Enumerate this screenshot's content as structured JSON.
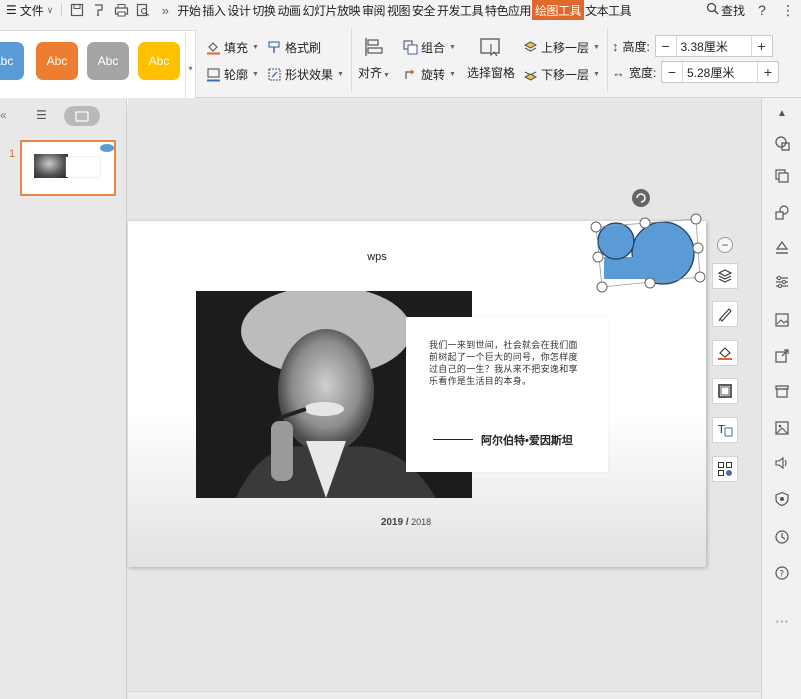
{
  "menubar": {
    "file_label": "文件",
    "tabs": [
      "开始",
      "插入",
      "设计",
      "切换",
      "动画",
      "幻灯片放映",
      "审阅",
      "视图",
      "安全",
      "开发工具",
      "特色应用",
      "绘图工具",
      "文本工具"
    ],
    "active_tab": "绘图工具",
    "search_label": "查找",
    "more_arrows": "»"
  },
  "ribbon": {
    "style_swatches": [
      {
        "label": "Abc",
        "color": "#5b9bd5"
      },
      {
        "label": "Abc",
        "color": "#ed7d31"
      },
      {
        "label": "Abc",
        "color": "#a5a5a5"
      },
      {
        "label": "Abc",
        "color": "#ffc000"
      }
    ],
    "fill_label": "填充",
    "format_painter_label": "格式刷",
    "outline_label": "轮廓",
    "shape_effects_label": "形状效果",
    "align_label": "对齐",
    "group_label": "组合",
    "rotate_label": "旋转",
    "selection_pane_label": "选择窗格",
    "bring_forward_label": "上移一层",
    "send_backward_label": "下移一层",
    "height_label": "高度:",
    "height_value": "3.38厘米",
    "width_label": "宽度:",
    "width_value": "5.28厘米"
  },
  "slides_pane": {
    "slide_number": "1"
  },
  "slide": {
    "title": "wps",
    "quote": "我们一来到世间，社会就会在我们面前树起了一个巨大的问号，你怎样度过自己的一生？我从来不把安逸和享乐看作是生活目的本身。",
    "author": "阿尔伯特•爱因斯坦",
    "year_main": "2019 /",
    "year_sub": "2018",
    "shape_color": "#5b9bd5"
  }
}
